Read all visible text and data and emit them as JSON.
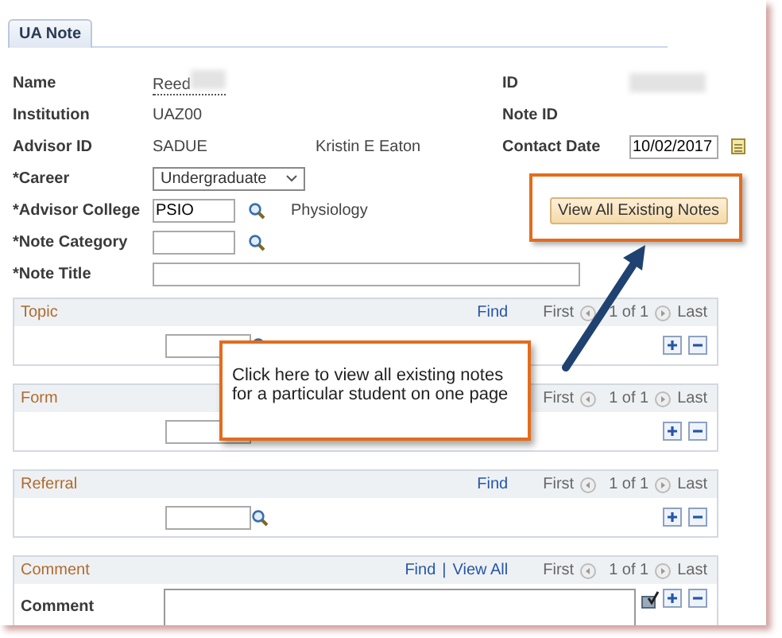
{
  "tab": {
    "label": "UA Note",
    "selected": true
  },
  "rows": [
    {
      "kind": "text",
      "label": "Name",
      "value": "Reed",
      "redacted": true,
      "right_label": "ID",
      "right_redacted": true
    },
    {
      "kind": "text",
      "label": "Institution",
      "value": "UAZ00",
      "right_label": "Note ID"
    },
    {
      "kind": "text",
      "label": "Advisor ID",
      "value": "SADUE",
      "extra": "Kristin E Eaton",
      "right_label": "Contact Date",
      "right_value": "10/02/2017"
    },
    {
      "kind": "select",
      "label": "*Career",
      "value": "Undergraduate"
    },
    {
      "kind": "lookup",
      "label": "*Advisor College",
      "value": "PSIO",
      "extra": "Physiology",
      "button": "View All Existing Notes"
    },
    {
      "kind": "lookup",
      "label": "*Note Category"
    },
    {
      "kind": "wide",
      "label": "*Note Title"
    }
  ],
  "sections": [
    {
      "kind": "lookup",
      "title": "Topic",
      "find": "Find",
      "first": "First",
      "count": "1 of 1",
      "last": "Last"
    },
    {
      "kind": "lookup",
      "title": "Form",
      "first": "First",
      "count": "1 of 1",
      "last": "Last"
    },
    {
      "kind": "lookup",
      "title": "Referral",
      "find": "Find",
      "first": "First",
      "count": "1 of 1",
      "last": "Last"
    },
    {
      "kind": "comment",
      "title": "Comment",
      "find": "Find",
      "separator": "|",
      "view_all": "View All",
      "first": "First",
      "count": "1 of 1",
      "last": "Last",
      "field_label": "Comment"
    }
  ],
  "callout": {
    "text": "Click here to view all existing notes for a particular student on one page"
  }
}
